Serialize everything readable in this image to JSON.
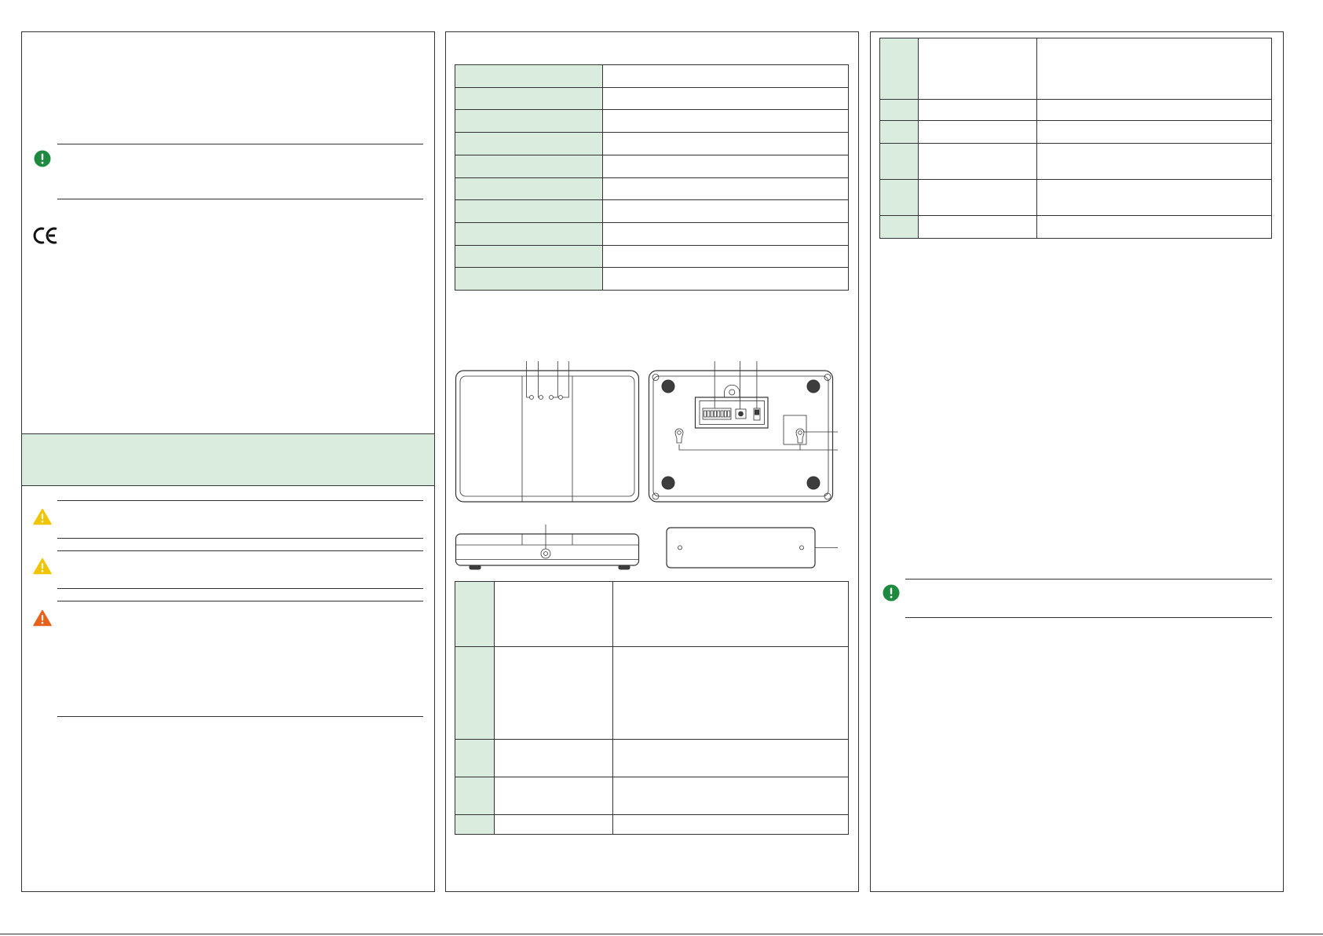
{
  "theme": {
    "accent_fill": "#d9ecdd",
    "note_icon_color": "#1d8a3f",
    "caution_icon_color": "#f2c400",
    "warning_icon_color": "#e8611a",
    "line_color": "#333333"
  },
  "logo": {
    "ce_mark": "CE"
  },
  "icons": {
    "note": "exclamation-circle-icon",
    "caution": "warning-triangle-icon",
    "warning": "warning-triangle-icon"
  },
  "spec_table": {
    "rows": [
      [
        "",
        ""
      ],
      [
        "",
        ""
      ],
      [
        "",
        ""
      ],
      [
        "",
        ""
      ],
      [
        "",
        ""
      ],
      [
        "",
        ""
      ],
      [
        "",
        ""
      ],
      [
        "",
        ""
      ],
      [
        "",
        ""
      ],
      [
        "",
        ""
      ]
    ]
  },
  "parts_table_front": {
    "rows": [
      [
        "",
        "",
        ""
      ],
      [
        "",
        "",
        ""
      ],
      [
        "",
        "",
        ""
      ],
      [
        "",
        "",
        ""
      ],
      [
        "",
        "",
        ""
      ]
    ]
  },
  "parts_table_back": {
    "rows": [
      [
        "",
        "",
        ""
      ],
      [
        "",
        "",
        ""
      ],
      [
        "",
        "",
        ""
      ],
      [
        "",
        "",
        ""
      ],
      [
        "",
        "",
        ""
      ],
      [
        "",
        "",
        ""
      ]
    ]
  }
}
